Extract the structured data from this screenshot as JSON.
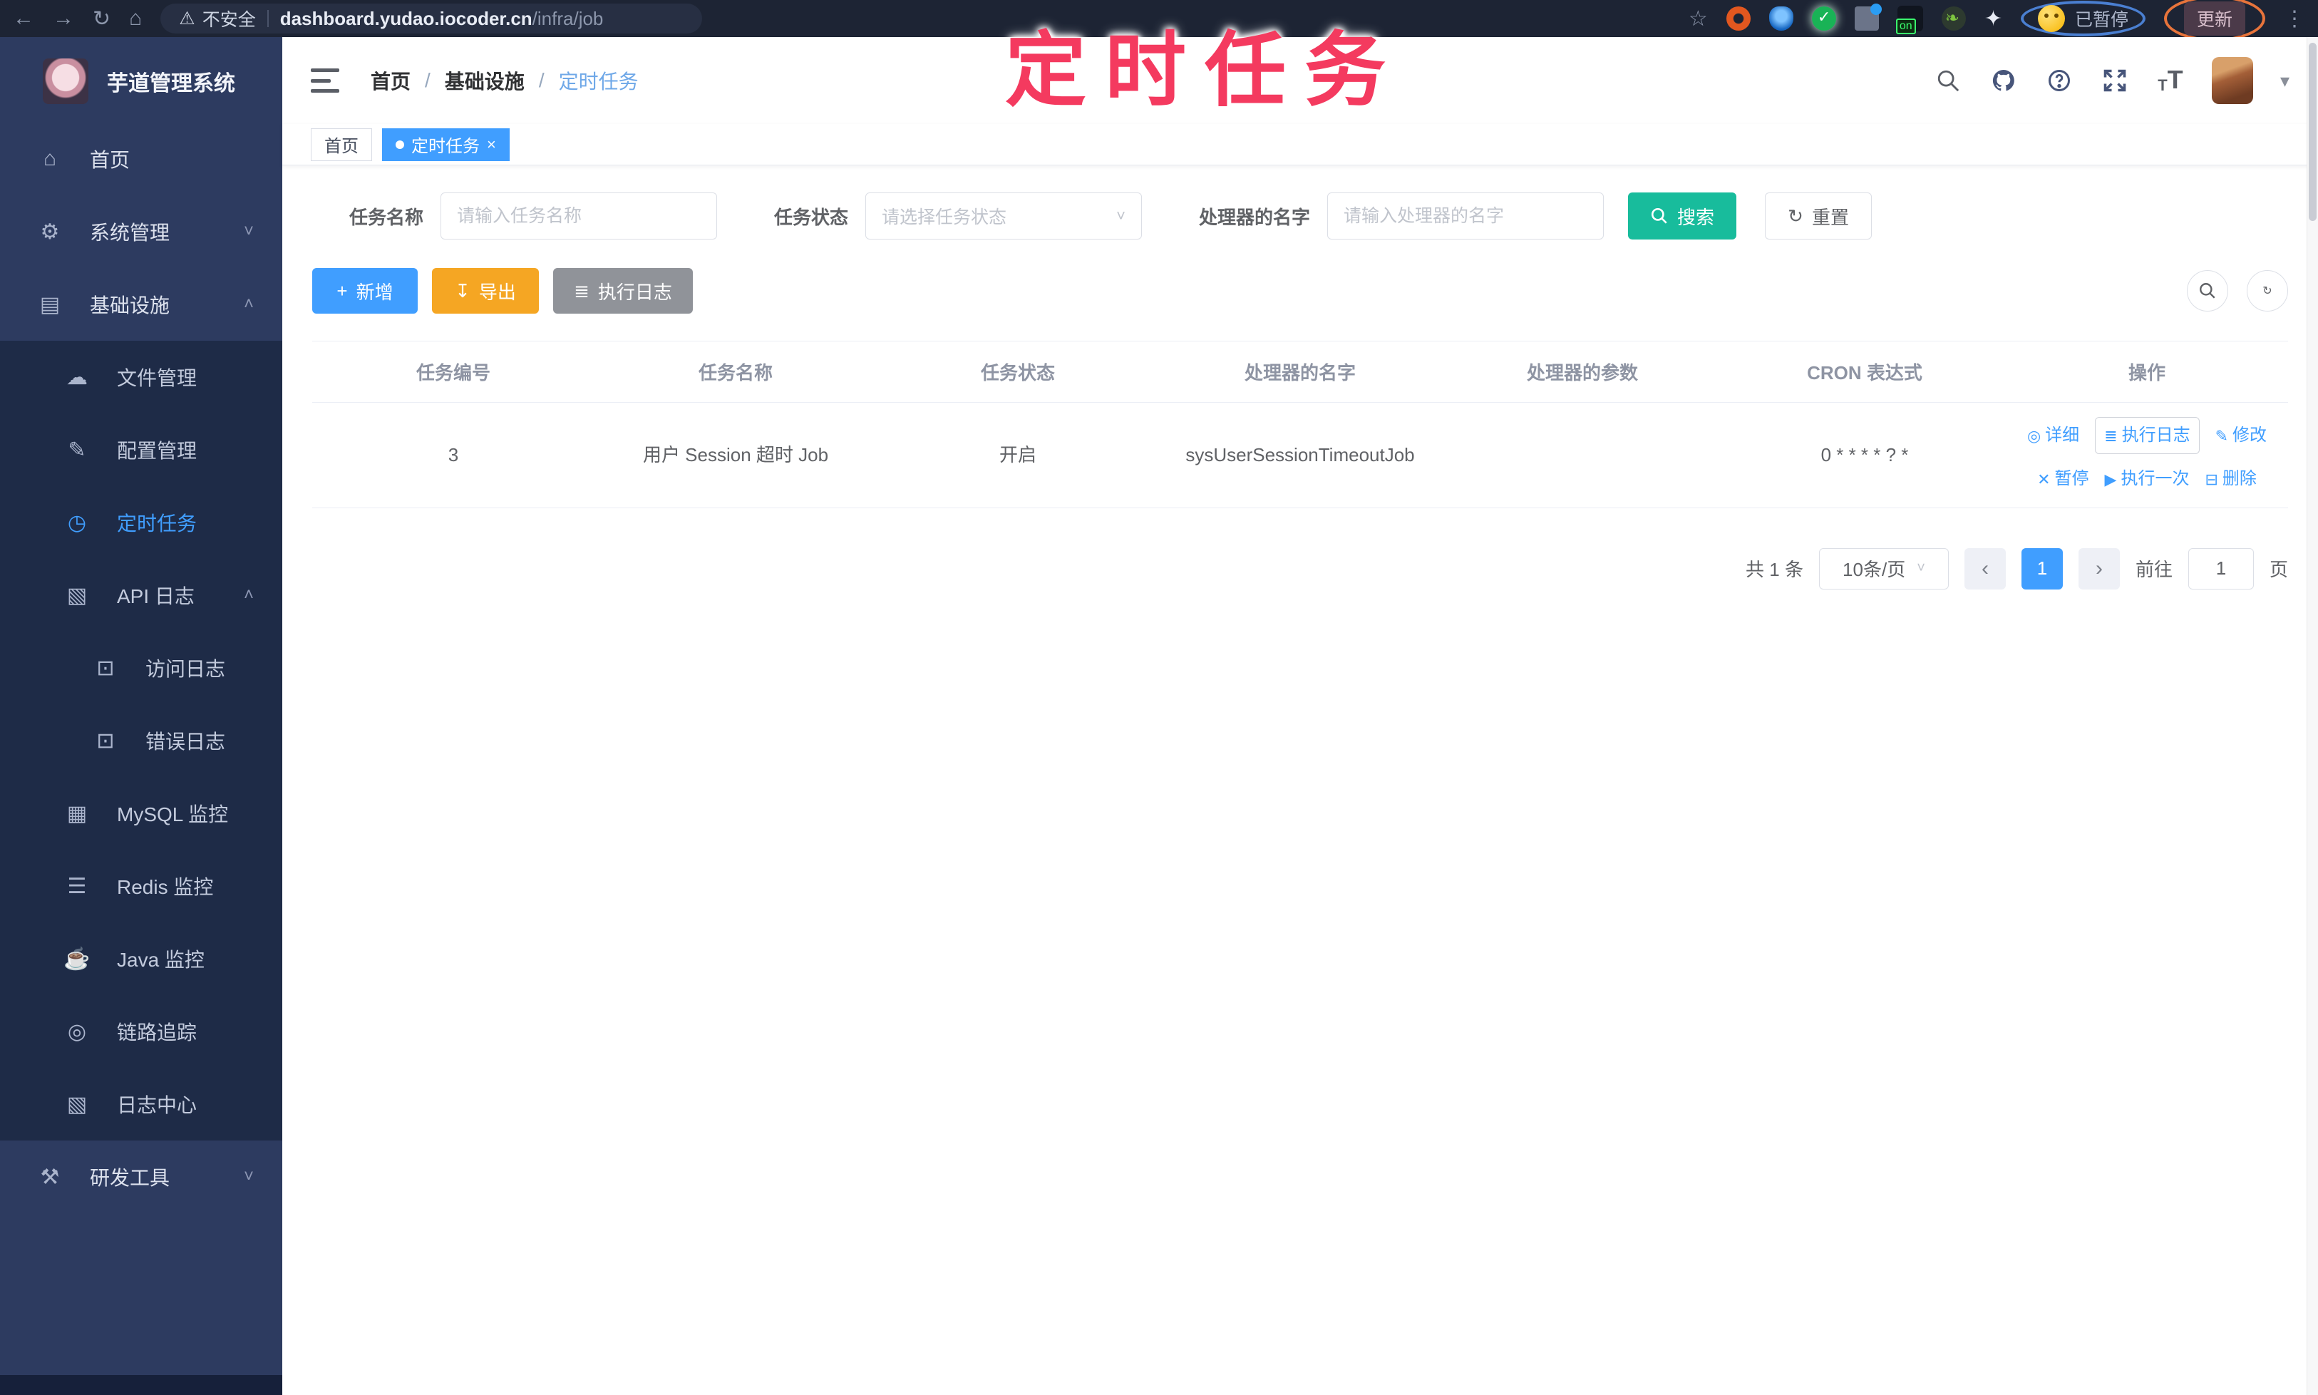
{
  "browser": {
    "security_label": "不安全",
    "url_domain": "dashboard.yudao.iocoder.cn",
    "url_path": "/infra/job",
    "on_badge": "on",
    "profile_status": "已暂停",
    "update_label": "更新"
  },
  "annotation": {
    "text": "定时任务",
    "color": "#f43a5f"
  },
  "sidebar": {
    "title": "芋道管理系统",
    "items": [
      {
        "label": "首页",
        "icon": "home-icon",
        "level": 1
      },
      {
        "label": "系统管理",
        "icon": "gear-icon",
        "level": 1,
        "chevron": "down"
      },
      {
        "label": "基础设施",
        "icon": "infrastructure-icon",
        "level": 1,
        "chevron": "up"
      },
      {
        "label": "文件管理",
        "icon": "cloud-upload-icon",
        "level": 2
      },
      {
        "label": "配置管理",
        "icon": "edit-icon",
        "level": 2
      },
      {
        "label": "定时任务",
        "icon": "clock-icon",
        "level": 2,
        "active": true
      },
      {
        "label": "API 日志",
        "icon": "log-icon",
        "level": 2,
        "chevron": "up"
      },
      {
        "label": "访问日志",
        "icon": "document-icon",
        "level": 3
      },
      {
        "label": "错误日志",
        "icon": "document-icon",
        "level": 3
      },
      {
        "label": "MySQL 监控",
        "icon": "database-icon",
        "level": 2
      },
      {
        "label": "Redis 监控",
        "icon": "layers-icon",
        "level": 2
      },
      {
        "label": "Java 监控",
        "icon": "monitor-icon",
        "level": 2
      },
      {
        "label": "链路追踪",
        "icon": "eye-icon",
        "level": 2
      },
      {
        "label": "日志中心",
        "icon": "log-center-icon",
        "level": 2
      },
      {
        "label": "研发工具",
        "icon": "toolbox-icon",
        "level": 1,
        "chevron": "down"
      }
    ]
  },
  "header": {
    "breadcrumb": {
      "items": [
        "首页",
        "基础设施",
        "定时任务"
      ],
      "separator": "/"
    }
  },
  "tabs": [
    {
      "label": "首页",
      "active": false
    },
    {
      "label": "定时任务",
      "active": true,
      "closable": true
    }
  ],
  "filters": {
    "name_label": "任务名称",
    "name_placeholder": "请输入任务名称",
    "status_label": "任务状态",
    "status_placeholder": "请选择任务状态",
    "handler_label": "处理器的名字",
    "handler_placeholder": "请输入处理器的名字",
    "search_label": "搜索",
    "reset_label": "重置"
  },
  "toolbar": {
    "add_label": "新增",
    "export_label": "导出",
    "exec_log_label": "执行日志"
  },
  "table": {
    "headers": [
      "任务编号",
      "任务名称",
      "任务状态",
      "处理器的名字",
      "处理器的参数",
      "CRON 表达式",
      "操作"
    ],
    "rows": [
      {
        "id": "3",
        "name": "用户 Session 超时 Job",
        "status": "开启",
        "handler": "sysUserSessionTimeoutJob",
        "param": "",
        "cron": "0 * * * * ? *"
      }
    ],
    "actions": [
      "详细",
      "执行日志",
      "修改",
      "暂停",
      "执行一次",
      "删除"
    ]
  },
  "pagination": {
    "total": "共 1 条",
    "page_size": "10条/页",
    "current": "1",
    "goto_label": "前往",
    "goto_value": "1",
    "page_suffix": "页"
  },
  "colors": {
    "accent": "#409eff",
    "search_button": "#18bc9c",
    "export_button": "#f5a623",
    "info_button": "#909399",
    "annotation": "#f43a5f",
    "sidebar_bg": "#2d3b60",
    "submenu_bg": "#1e2b47",
    "browser_bar": "#1d2434"
  }
}
